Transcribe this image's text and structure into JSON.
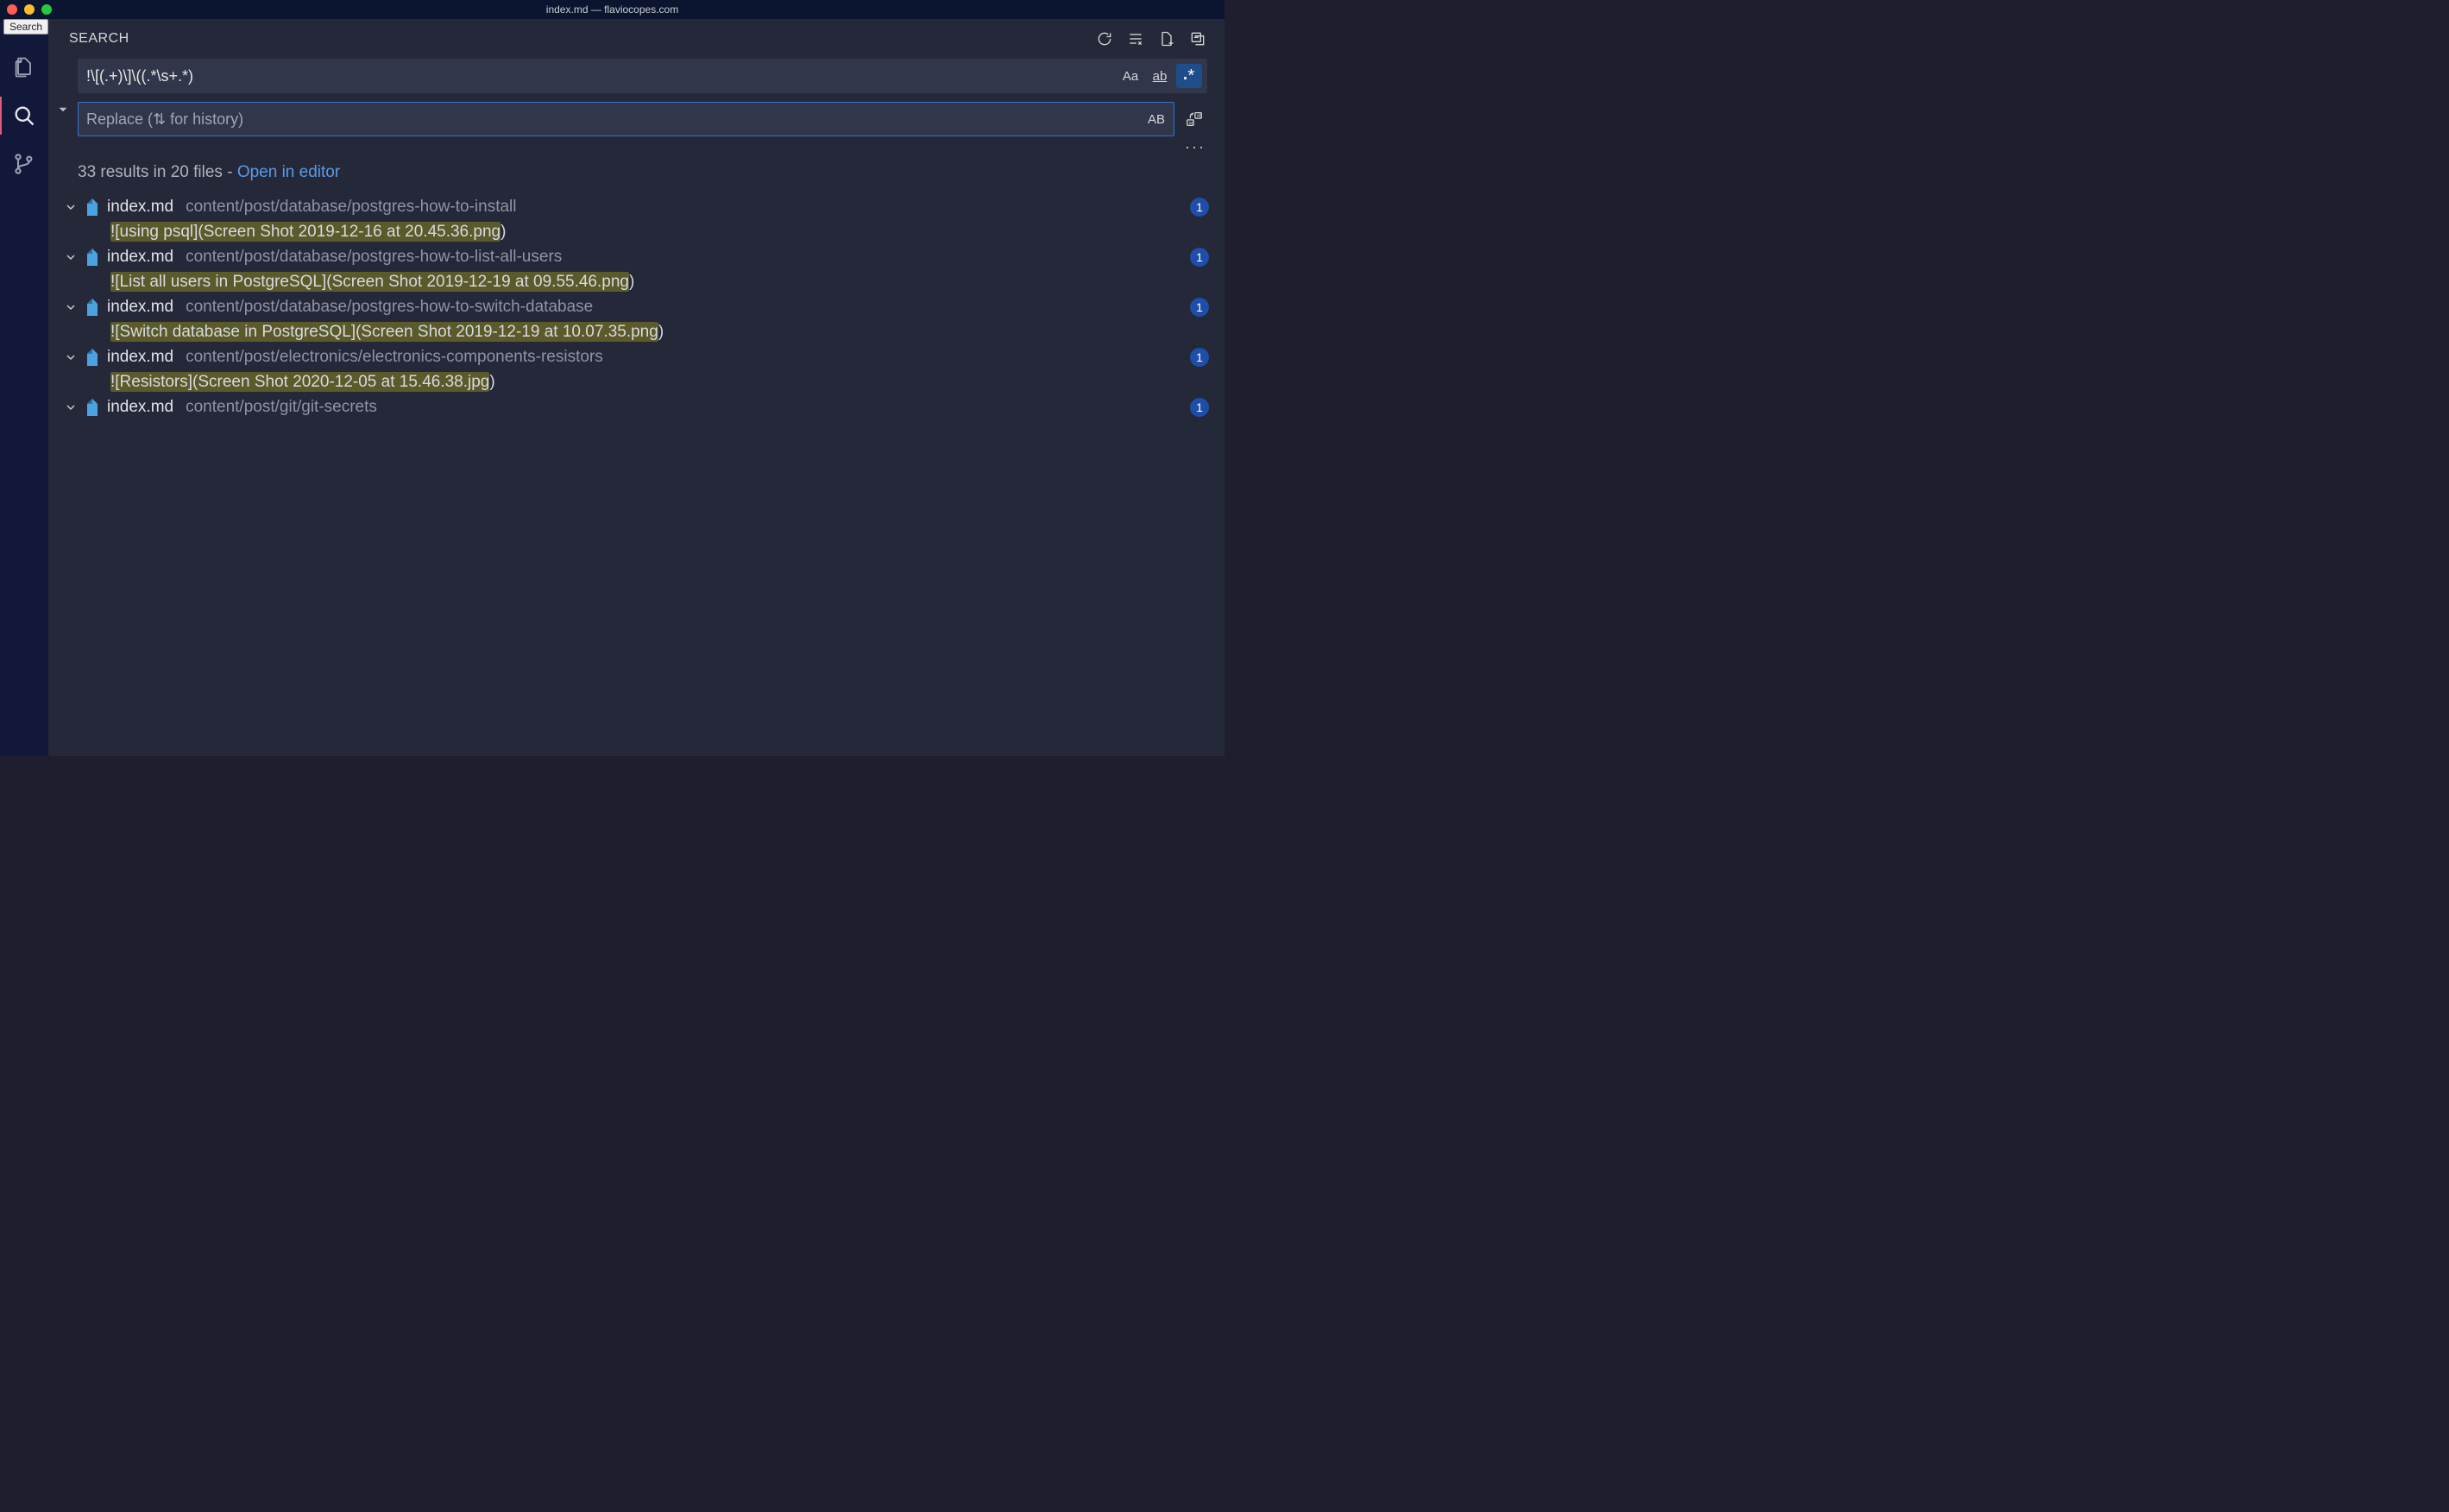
{
  "window": {
    "title": "index.md — flaviocopes.com",
    "tooltip": "Search"
  },
  "panel": {
    "title": "SEARCH"
  },
  "search": {
    "query": "!\\[(.+)\\]\\((.*\\s+.*)",
    "replace_placeholder": "Replace (⇅ for history)",
    "case_sensitive": "Aa",
    "whole_word": "ab",
    "regex_symbol": "*",
    "preserve_case": "AB"
  },
  "summary": {
    "text": "33 results in 20 files - ",
    "link": "Open in editor"
  },
  "ellipsis": "···",
  "results": [
    {
      "file": "index.md",
      "path": "content/post/database/postgres-how-to-install",
      "count": "1",
      "match_hl": "![using psql](Screen Shot 2019-12-16 at 20.45.36.png",
      "match_tail": ")"
    },
    {
      "file": "index.md",
      "path": "content/post/database/postgres-how-to-list-all-users",
      "count": "1",
      "match_hl": "![List all users in PostgreSQL](Screen Shot 2019-12-19 at 09.55.46.png",
      "match_tail": ")"
    },
    {
      "file": "index.md",
      "path": "content/post/database/postgres-how-to-switch-database",
      "count": "1",
      "match_hl": "![Switch database in PostgreSQL](Screen Shot 2019-12-19 at 10.07.35.png",
      "match_tail": ")"
    },
    {
      "file": "index.md",
      "path": "content/post/electronics/electronics-components-resistors",
      "count": "1",
      "match_hl": "![Resistors](Screen Shot 2020-12-05 at 15.46.38.jpg",
      "match_tail": ")"
    },
    {
      "file": "index.md",
      "path": "content/post/git/git-secrets",
      "count": "1",
      "match_hl": "",
      "match_tail": ""
    }
  ]
}
